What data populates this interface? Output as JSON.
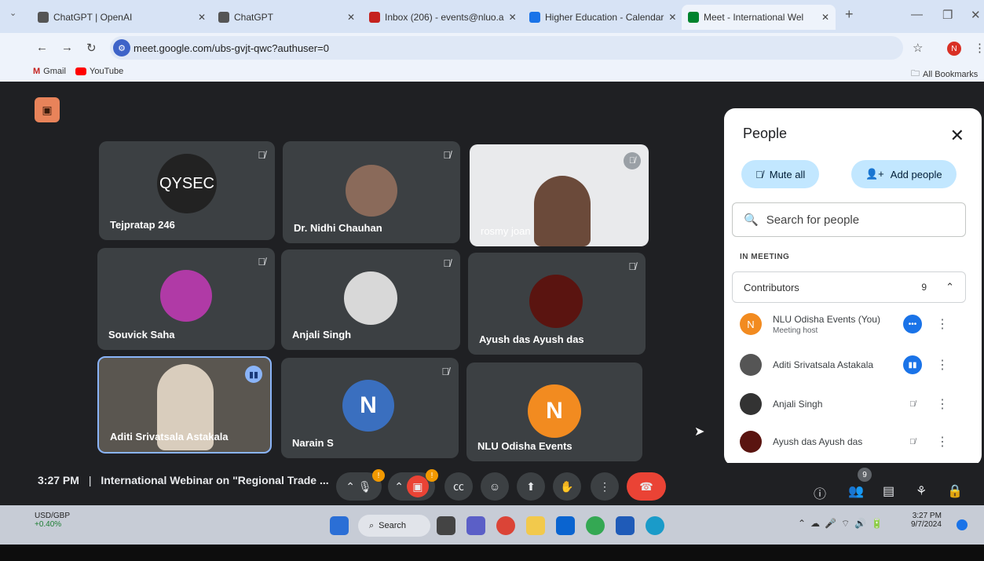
{
  "browser": {
    "tabs": [
      {
        "label": "ChatGPT | OpenAI"
      },
      {
        "label": "ChatGPT"
      },
      {
        "label": "Inbox (206) - events@nluo.a"
      },
      {
        "label": "Higher Education - Calendar"
      },
      {
        "label": "Meet - International Wel"
      }
    ],
    "new_tab": "+",
    "url": "meet.google.com/ubs-gvjt-qwc?authuser=0",
    "profile_initial": "N",
    "bookmarks": [
      {
        "label": "Gmail"
      },
      {
        "label": "YouTube"
      }
    ],
    "all_bookmarks": "All Bookmarks"
  },
  "tiles": [
    {
      "name": "Tejpratap 246",
      "avatar_text": "QYSEC"
    },
    {
      "name": "Dr. Nidhi Chauhan"
    },
    {
      "name": "rosmy joan"
    },
    {
      "name": "Souvick Saha"
    },
    {
      "name": "Anjali Singh"
    },
    {
      "name": "Ayush das Ayush das"
    },
    {
      "name": "Aditi Srivatsala Astakala"
    },
    {
      "name": "Narain S",
      "initial": "N"
    },
    {
      "name": "NLU Odisha Events",
      "initial": "N"
    }
  ],
  "people": {
    "title": "People",
    "mute_all": "Mute all",
    "add_people": "Add people",
    "search_placeholder": "Search for people",
    "section": "IN MEETING",
    "contributors_label": "Contributors",
    "contributors_count": "9",
    "rows": [
      {
        "name": "NLU Odisha Events (You)",
        "sub": "Meeting host",
        "initial": "N"
      },
      {
        "name": "Aditi Srivatsala Astakala"
      },
      {
        "name": "Anjali Singh"
      },
      {
        "name": "Ayush das Ayush das"
      }
    ]
  },
  "meeting": {
    "time": "3:27 PM",
    "separator": "|",
    "title": "International Webinar on \"Regional Trade ...",
    "participants_badge": "9"
  },
  "taskbar": {
    "ticker_name": "USD/GBP",
    "ticker_change": "+0.40%",
    "search": "Search",
    "clock_time": "3:27 PM",
    "clock_date": "9/7/2024"
  },
  "colors": {
    "accent": "#c2e7ff",
    "end_call": "#ea4335",
    "avatar_orange": "#f28b20",
    "avatar_blue": "#3a6fbf"
  }
}
